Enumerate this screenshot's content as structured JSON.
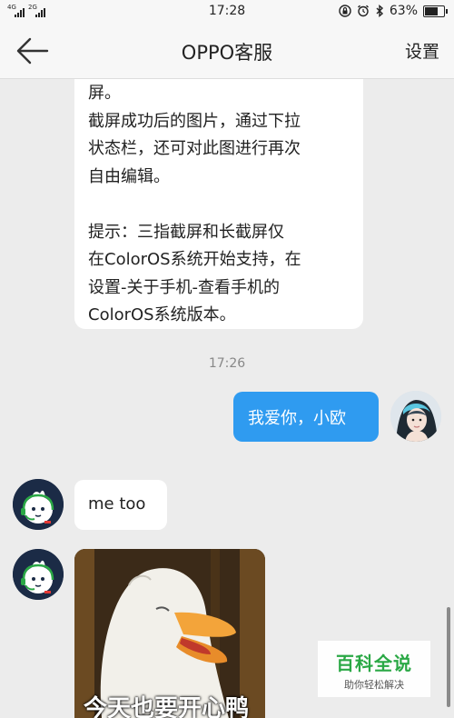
{
  "status_bar": {
    "sim1_network": "4G",
    "sim2_network": "2G",
    "time": "17:28",
    "battery_percent": "63%",
    "battery_level": 0.63
  },
  "header": {
    "back_icon": "back-arrow-icon",
    "title": "OPPO客服",
    "settings_label": "设置"
  },
  "messages": {
    "agent_message": {
      "lines": [
        "屏。",
        "截屏成功后的图片，通过下拉",
        "状态栏，还可对此图进行再次",
        "自由编辑。",
        "",
        "提示：三指截屏和长截屏仅",
        "在ColorOS系统开始支持，在",
        "设置-关于手机-查看手机的",
        "ColorOS系统版本。"
      ]
    },
    "timestamp": "17:26",
    "user_message": "我爱你，小欧",
    "reply_text": "me too",
    "sticker_caption": "今天也要开心鸭"
  },
  "watermark": {
    "title": "百科全说",
    "subtitle": "助你轻松解决"
  },
  "colors": {
    "accent_blue": "#2f9bf0",
    "background": "#ececec",
    "watermark_green": "#2aa845"
  }
}
